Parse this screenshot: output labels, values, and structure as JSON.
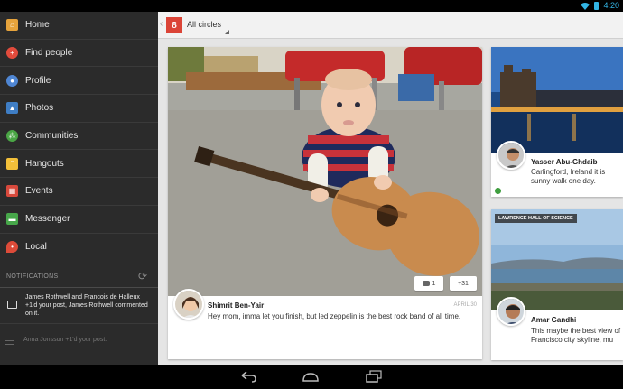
{
  "status_bar": {
    "time": "4:20"
  },
  "drawer": {
    "items": [
      {
        "label": "Home",
        "icon": "home-icon",
        "color": "#e6a33c"
      },
      {
        "label": "Find people",
        "icon": "find-people-icon",
        "color": "#e14b3c"
      },
      {
        "label": "Profile",
        "icon": "profile-icon",
        "color": "#4f86d3"
      },
      {
        "label": "Photos",
        "icon": "photos-icon",
        "color": "#3f7ec5"
      },
      {
        "label": "Communities",
        "icon": "communities-icon",
        "color": "#4aa545"
      },
      {
        "label": "Hangouts",
        "icon": "hangouts-icon",
        "color": "#f3c03a"
      },
      {
        "label": "Events",
        "icon": "events-icon",
        "color": "#d8493c"
      },
      {
        "label": "Messenger",
        "icon": "messenger-icon",
        "color": "#47a74a"
      },
      {
        "label": "Local",
        "icon": "local-icon",
        "color": "#dd4b39"
      }
    ],
    "notifications_label": "NOTIFICATIONS",
    "notifications": [
      {
        "text": "James Rothwell and Francois de Halleux +1'd your post, James Rothwell commented on it."
      },
      {
        "text": "Anna Jonsson +1'd your post."
      }
    ]
  },
  "topbar": {
    "logo": "8",
    "circle_filter": "All circles"
  },
  "main_post": {
    "author": "Shimrit Ben-Yair",
    "date": "APRIL 30",
    "text": "Hey mom, imma let you finish, but led zeppelin is the best rock band of all time.",
    "comments": "1",
    "plus_ones": "+31"
  },
  "side_posts": [
    {
      "author": "Yasser Abu-Ghdaib",
      "text": "Carlingford, Ireland it is sunny walk one day."
    },
    {
      "tag": "LAWRENCE HALL OF SCIENCE",
      "author": "Amar Gandhi",
      "text": "This maybe the best view of Francisco city skyline, mu"
    }
  ],
  "colors": {
    "accent": "#db4437",
    "status": "#33b5e5"
  }
}
